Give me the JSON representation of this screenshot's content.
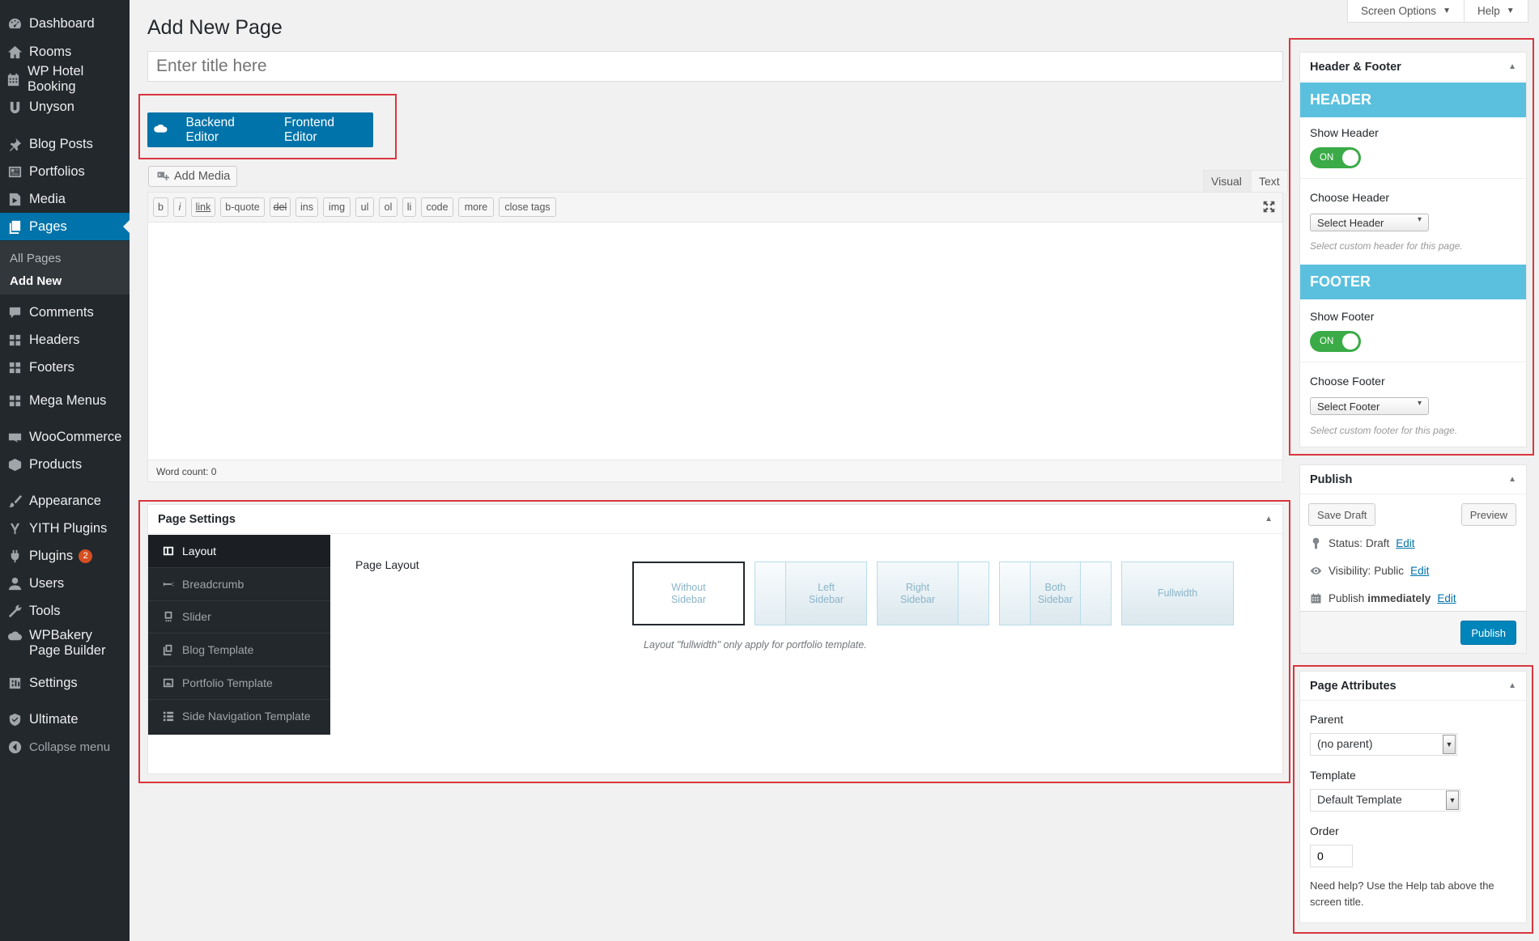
{
  "sidebar": {
    "items": [
      {
        "label": "Dashboard",
        "icon": "dashboard-icon"
      },
      {
        "label": "Rooms",
        "icon": "home-icon"
      },
      {
        "label": "WP Hotel Booking",
        "icon": "calendar-icon"
      },
      {
        "label": "Unyson",
        "icon": "unyson-icon"
      },
      {
        "label": "Blog Posts",
        "icon": "pushpin-icon"
      },
      {
        "label": "Portfolios",
        "icon": "portfolio-icon"
      },
      {
        "label": "Media",
        "icon": "media-icon"
      },
      {
        "label": "Pages",
        "icon": "pages-icon"
      },
      {
        "label": "Comments",
        "icon": "comment-icon"
      },
      {
        "label": "Headers",
        "icon": "grid-icon"
      },
      {
        "label": "Footers",
        "icon": "grid-icon"
      },
      {
        "label": "Mega Menus",
        "icon": "grid-icon"
      },
      {
        "label": "WooCommerce",
        "icon": "woo-icon"
      },
      {
        "label": "Products",
        "icon": "box-icon"
      },
      {
        "label": "Appearance",
        "icon": "brush-icon"
      },
      {
        "label": "YITH Plugins",
        "icon": "yith-icon"
      },
      {
        "label": "Plugins",
        "icon": "plug-icon",
        "badge": "2"
      },
      {
        "label": "Users",
        "icon": "user-icon"
      },
      {
        "label": "Tools",
        "icon": "wrench-icon"
      },
      {
        "label": "WPBakery Page Builder",
        "icon": "wpbakery-icon"
      },
      {
        "label": "Settings",
        "icon": "settings-icon"
      },
      {
        "label": "Ultimate",
        "icon": "shield-icon"
      }
    ],
    "submenu": {
      "all_pages": "All Pages",
      "add_new": "Add New"
    },
    "collapse_label": "Collapse menu"
  },
  "top_buttons": {
    "screen_options": "Screen Options",
    "help": "Help"
  },
  "page_title": "Add New Page",
  "title_placeholder": "Enter title here",
  "builder": {
    "backend": "Backend Editor",
    "frontend": "Frontend Editor"
  },
  "editor": {
    "add_media": "Add Media",
    "tabs": {
      "visual": "Visual",
      "text": "Text"
    },
    "quicktags": [
      "b",
      "i",
      "link",
      "b-quote",
      "del",
      "ins",
      "img",
      "ul",
      "ol",
      "li",
      "code",
      "more",
      "close tags"
    ],
    "word_count": "Word count: 0"
  },
  "page_settings": {
    "title": "Page Settings",
    "nav": [
      "Layout",
      "Breadcrumb",
      "Slider",
      "Blog Template",
      "Portfolio Template",
      "Side Navigation Template"
    ],
    "field_label": "Page Layout",
    "layouts": [
      "Without Sidebar",
      "Left Sidebar",
      "Right Sidebar",
      "Both Sidebar",
      "Fullwidth"
    ],
    "selected_layout": "Without Sidebar",
    "note": "Layout \"fullwidth\" only apply for portfolio template."
  },
  "header_footer": {
    "title": "Header & Footer",
    "header_band": "HEADER",
    "show_header": "Show Header",
    "header_switch": "ON",
    "choose_header": "Choose Header",
    "header_select": "Select Header",
    "header_hint": "Select custom header for this page.",
    "footer_band": "FOOTER",
    "show_footer": "Show Footer",
    "footer_switch": "ON",
    "choose_footer": "Choose Footer",
    "footer_select": "Select Footer",
    "footer_hint": "Select custom footer for this page."
  },
  "publish": {
    "title": "Publish",
    "save_draft": "Save Draft",
    "preview": "Preview",
    "status_label": "Status:",
    "status_value": "Draft",
    "visibility_label": "Visibility:",
    "visibility_value": "Public",
    "schedule_label": "Publish",
    "schedule_value": "immediately",
    "edit": "Edit",
    "publish_button": "Publish"
  },
  "page_attributes": {
    "title": "Page Attributes",
    "parent_label": "Parent",
    "parent_value": "(no parent)",
    "template_label": "Template",
    "template_value": "Default Template",
    "order_label": "Order",
    "order_value": "0",
    "help": "Need help? Use the Help tab above the screen title."
  },
  "colors": {
    "sidebar": "#23282d",
    "accent": "#0073aa",
    "highlight_box": "#d9363e",
    "band": "#5bc0de",
    "switch_on": "#3aab47"
  }
}
